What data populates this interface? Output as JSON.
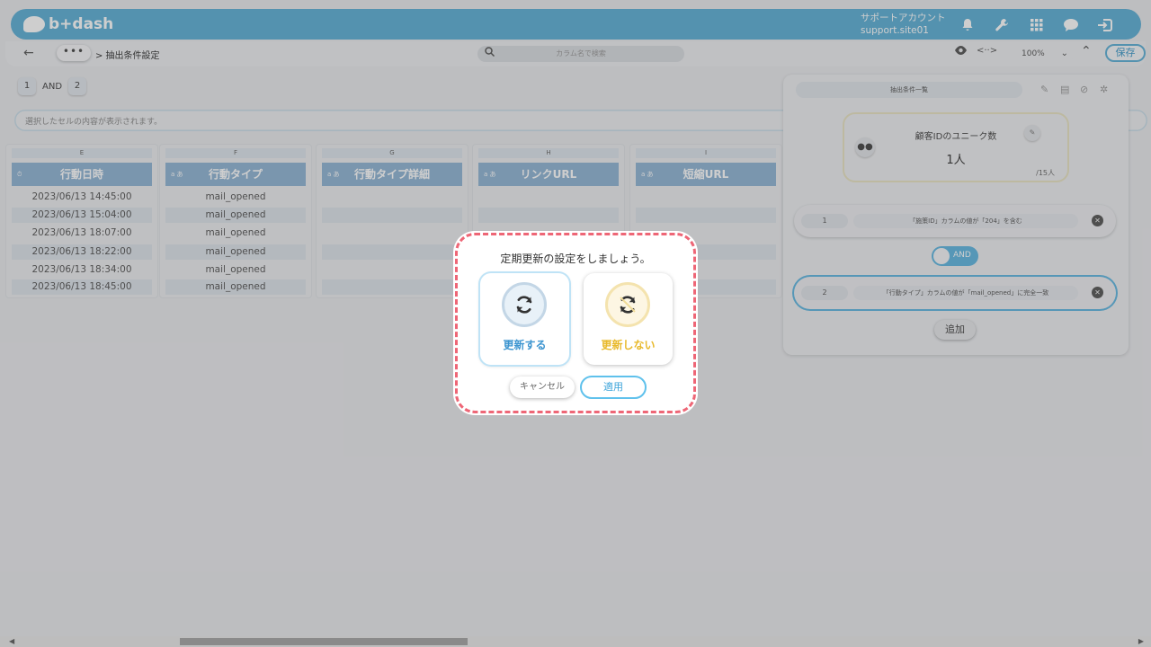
{
  "header": {
    "logo_text": "b+dash",
    "account_line1": "サポートアカウント",
    "account_line2": "support.site01",
    "icons": [
      "bell-icon",
      "wrench-icon",
      "grid-icon",
      "chat-icon",
      "logout-icon"
    ],
    "color": "#5dafd6"
  },
  "toolbar": {
    "back": "←",
    "more": "•••",
    "breadcrumb": "> 抽出条件設定",
    "search_placeholder": "カラム名で検索",
    "zoom": "100%",
    "save_label": "保存"
  },
  "filter_chips": {
    "first": "1",
    "op": "AND",
    "second": "2"
  },
  "selection_bar": "選択したセルの内容が表示されます。",
  "columns": [
    {
      "letter": "E",
      "tag": "⏱",
      "name": "行動日時",
      "cells": [
        "2023/06/13 14:45:00",
        "2023/06/13 15:04:00",
        "2023/06/13 18:07:00",
        "2023/06/13 18:22:00",
        "2023/06/13 18:34:00",
        "2023/06/13 18:45:00"
      ]
    },
    {
      "letter": "F",
      "tag": "a あ",
      "name": "行動タイプ",
      "cells": [
        "mail_opened",
        "mail_opened",
        "mail_opened",
        "mail_opened",
        "mail_opened",
        "mail_opened"
      ]
    },
    {
      "letter": "G",
      "tag": "a あ",
      "name": "行動タイプ詳細",
      "cells": [
        "",
        "",
        "",
        "",
        "",
        ""
      ]
    },
    {
      "letter": "H",
      "tag": "a あ",
      "name": "リンクURL",
      "cells": [
        "",
        "",
        "",
        "",
        "",
        ""
      ]
    },
    {
      "letter": "I",
      "tag": "a あ",
      "name": "短縮URL",
      "cells": [
        "",
        "",
        "",
        "",
        "",
        ""
      ]
    }
  ],
  "panel": {
    "tab_label": "抽出条件一覧",
    "card": {
      "title": "顧客IDのユニーク数",
      "value": "1人",
      "sub": "/15人"
    },
    "conditions": [
      {
        "num": "1",
        "text": "「施策ID」カラムの値が「204」を含む"
      },
      {
        "num": "2",
        "text": "「行動タイプ」カラムの値が「mail_opened」に完全一致"
      }
    ],
    "and_label": "AND",
    "add_label": "追加"
  },
  "dialog": {
    "title": "定期更新の設定をしましょう。",
    "option_update": "更新する",
    "option_no_update": "更新しない",
    "cancel": "キャンセル",
    "apply": "適用",
    "colors": {
      "border": "#ee6676",
      "update": "#3d95d0",
      "no_update": "#e8b92b"
    }
  }
}
